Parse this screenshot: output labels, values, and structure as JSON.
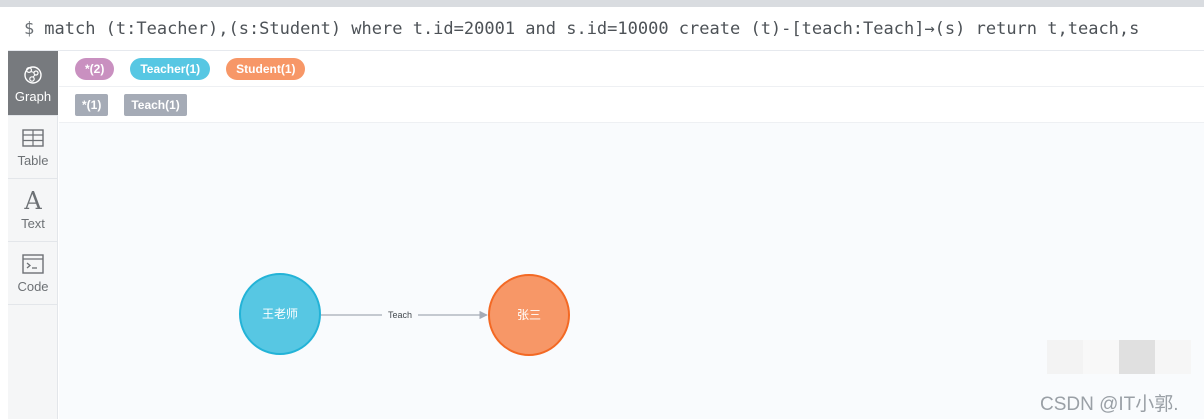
{
  "query": {
    "prompt": "$",
    "text": "match (t:Teacher),(s:Student) where t.id=20001 and s.id=10000 create (t)-[teach:Teach]→(s) return t,teach,s"
  },
  "nav": [
    {
      "label": "Graph",
      "icon": "graph-icon",
      "active": true
    },
    {
      "label": "Table",
      "icon": "table-icon"
    },
    {
      "label": "Text",
      "icon": "text-icon",
      "glyph": "A"
    },
    {
      "label": "Code",
      "icon": "code-icon"
    }
  ],
  "node_labels": [
    {
      "label": "*(2)",
      "color": "#c990c0"
    },
    {
      "label": "Teacher(1)",
      "color": "#57c7e3"
    },
    {
      "label": "Student(1)",
      "color": "#f79767"
    }
  ],
  "relationship_types": [
    {
      "label": "*(1)",
      "color": "#a5abb6"
    },
    {
      "label": "Teach(1)",
      "color": "#a5abb6"
    }
  ],
  "graph": {
    "nodes": [
      {
        "label": "王老师",
        "color": "#57c7e3",
        "border": "#23b3d7"
      },
      {
        "label": "张三",
        "color": "#f79767",
        "border": "#f36924"
      }
    ],
    "relationship": {
      "label": "Teach",
      "color": "#a5abb6"
    }
  },
  "watermark": "CSDN @IT小郭."
}
